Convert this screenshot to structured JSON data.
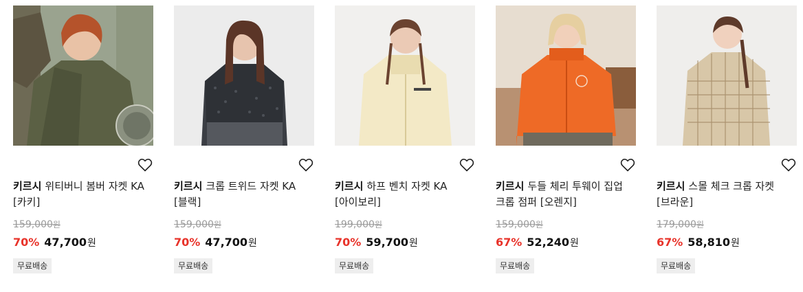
{
  "colors": {
    "discount": "#e8332a",
    "badge_bg": "#eeeeee",
    "strike": "#9a9a9a"
  },
  "products": [
    {
      "brand": "키르시",
      "name": "위티버니 봄버 자켓 KA [카키]",
      "original_price": "159,000",
      "original_currency": "원",
      "discount": "70%",
      "sale_price": "47,700",
      "currency": "원",
      "badge": "무료배송",
      "wish_icon": "heart-outline-icon",
      "image_theme": "khaki bomber jacket"
    },
    {
      "brand": "키르시",
      "name": "크롭 트위드 자켓 KA [블랙]",
      "original_price": "159,000",
      "original_currency": "원",
      "discount": "70%",
      "sale_price": "47,700",
      "currency": "원",
      "badge": "무료배송",
      "wish_icon": "heart-outline-icon",
      "image_theme": "black tweed jacket"
    },
    {
      "brand": "키르시",
      "name": "하프 벤치 자켓 KA [아이보리]",
      "original_price": "199,000",
      "original_currency": "원",
      "discount": "70%",
      "sale_price": "59,700",
      "currency": "원",
      "badge": "무료배송",
      "wish_icon": "heart-outline-icon",
      "image_theme": "ivory hooded jacket"
    },
    {
      "brand": "키르시",
      "name": "두들 체리 투웨이 집업 크롭 점퍼 [오렌지]",
      "original_price": "159,000",
      "original_currency": "원",
      "discount": "67%",
      "sale_price": "52,240",
      "currency": "원",
      "badge": "무료배송",
      "wish_icon": "heart-outline-icon",
      "image_theme": "orange cropped jumper"
    },
    {
      "brand": "키르시",
      "name": "스몰 체크 크롭 자켓 [브라운]",
      "original_price": "179,000",
      "original_currency": "원",
      "discount": "67%",
      "sale_price": "58,810",
      "currency": "원",
      "badge": "무료배송",
      "wish_icon": "heart-outline-icon",
      "image_theme": "brown check jacket"
    }
  ]
}
